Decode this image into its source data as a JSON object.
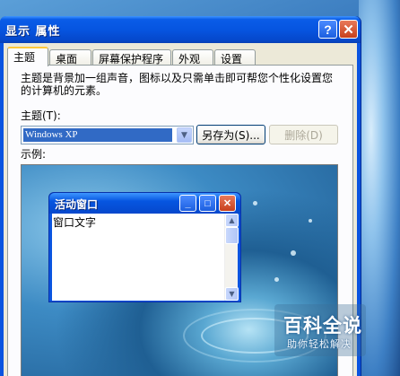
{
  "window": {
    "title": "显示 属性",
    "help_label": "?",
    "close_label": "✕"
  },
  "tabs": [
    {
      "label": "主题",
      "active": true
    },
    {
      "label": "桌面",
      "active": false
    },
    {
      "label": "屏幕保护程序",
      "active": false
    },
    {
      "label": "外观",
      "active": false
    },
    {
      "label": "设置",
      "active": false
    }
  ],
  "themes_panel": {
    "description": "主题是背景加一组声音，图标以及只需单击即可帮您个性化设置您的计算机的元素。",
    "theme_label": "主题(T):",
    "theme_value": "Windows XP",
    "save_as_label": "另存为(S)...",
    "delete_label": "删除(D)",
    "preview_label": "示例:"
  },
  "preview_window": {
    "title": "活动窗口",
    "body_text": "窗口文字"
  },
  "icons": {
    "help": "question-icon",
    "close": "close-icon",
    "dropdown": "chevron-down-icon",
    "minimize": "minimize-icon",
    "maximize": "maximize-icon",
    "scroll_up": "arrow-up-icon",
    "scroll_down": "arrow-down-icon"
  },
  "watermark": {
    "title": "百科全说",
    "subtitle": "助你轻松解决"
  },
  "colors": {
    "titlebar": "#0655e0",
    "close": "#c8401c",
    "selection": "#316ac5",
    "active_tab_accent": "#ffc83c",
    "dialog_face": "#ece9d8"
  }
}
